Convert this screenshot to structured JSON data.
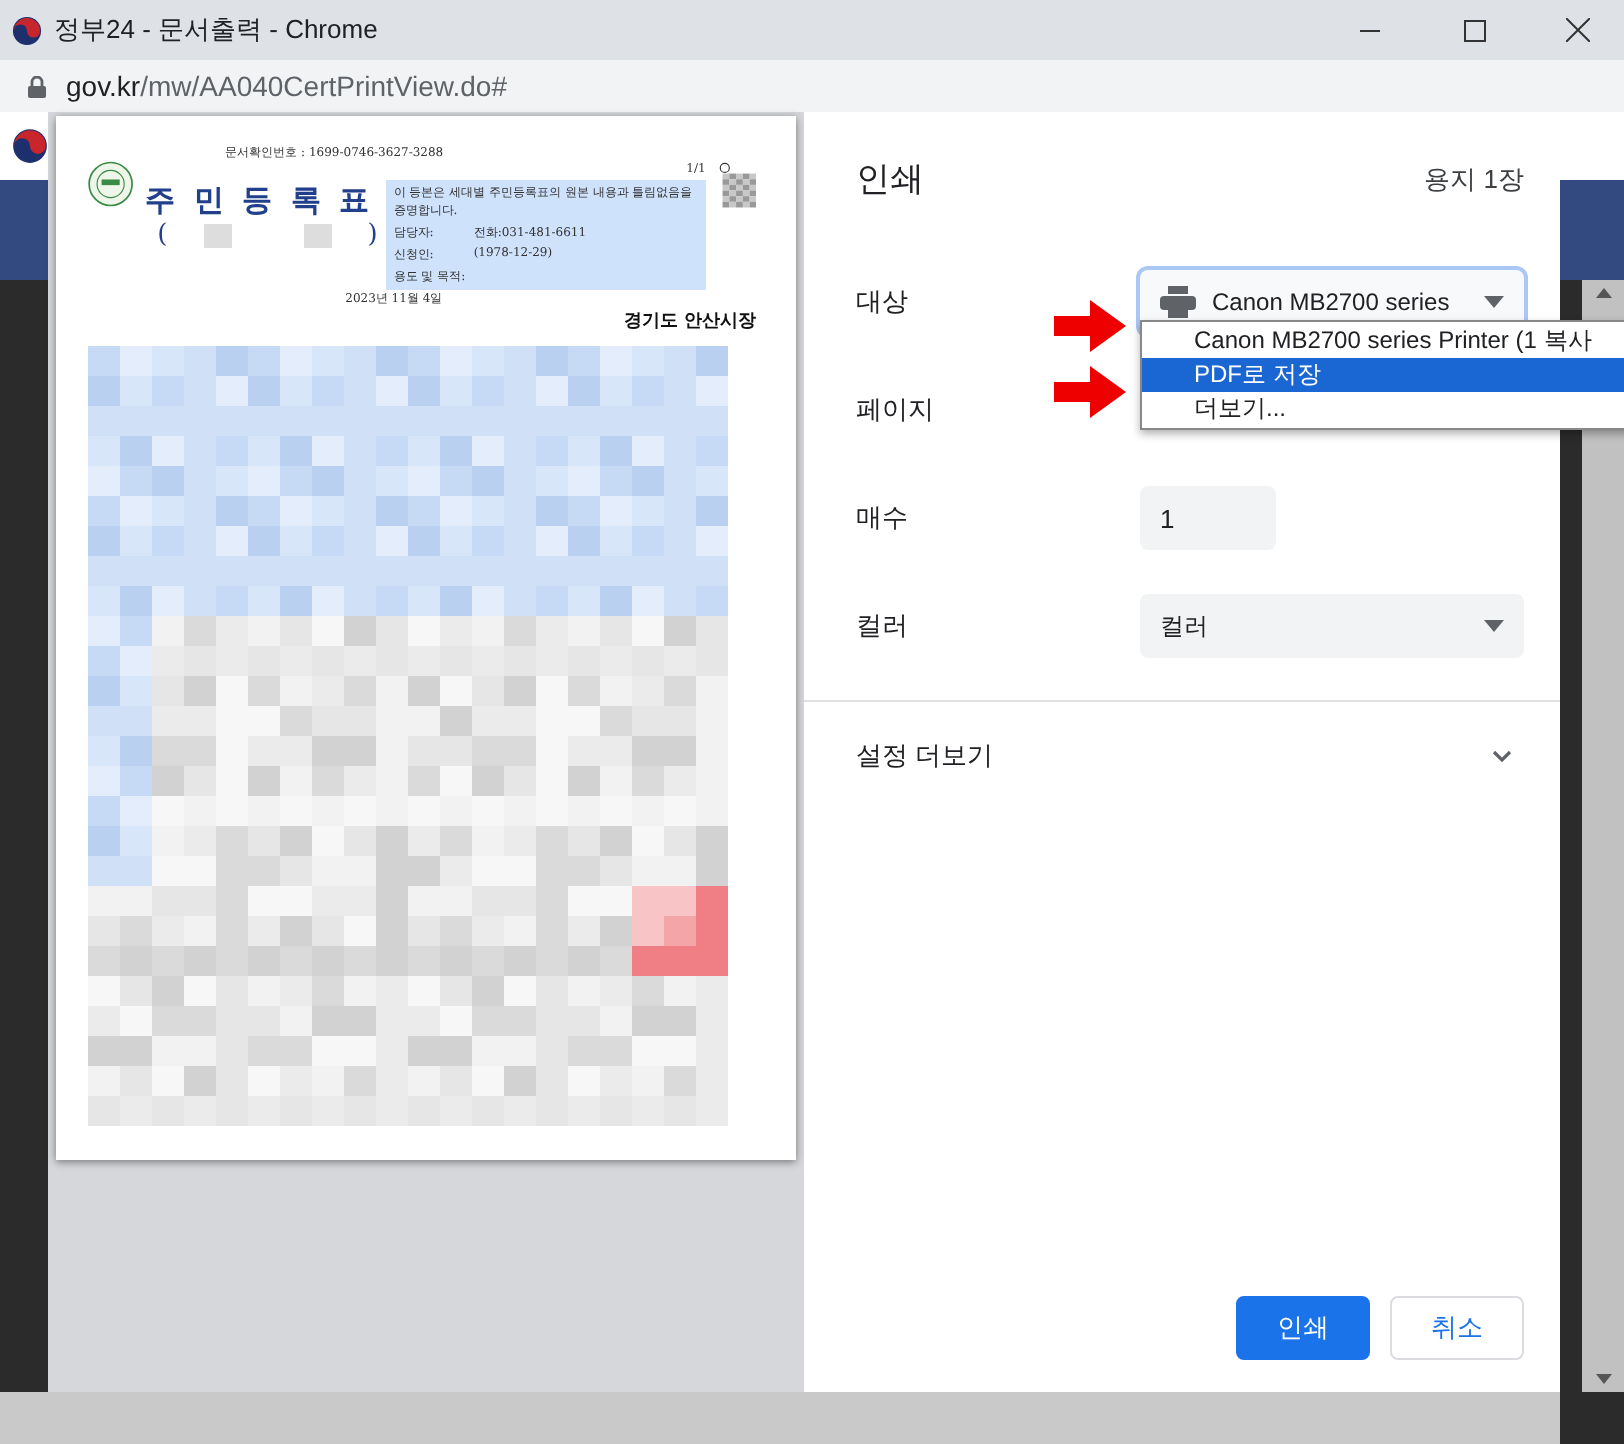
{
  "window": {
    "title": "정부24 - 문서출력 - Chrome",
    "address_host": "gov.kr",
    "address_path": "/mw/AA040CertPrintView.do#"
  },
  "document": {
    "doc_number": "문서확인번호 : 1699-0746-3627-3288",
    "page": "1/1",
    "title": "주 민 등 록 표",
    "paren_open": "(",
    "paren_close": ")",
    "notice": "이 등본은 세대별 주민등록표의 원본 내용과 틀림없음을 증명합니다.",
    "rows": [
      {
        "label": "담당자:",
        "value": "전화:031-481-6611"
      },
      {
        "label": "신청인:",
        "value": "(1978-12-29)"
      },
      {
        "label": "용도 및 목적:",
        "value": ""
      }
    ],
    "date": "2023년 11월 4일",
    "issuer": "경기도 안산시장"
  },
  "panel": {
    "title": "인쇄",
    "sheets": "용지 1장",
    "fields": [
      {
        "label": "대상",
        "kind": "printer",
        "value": "Canon MB2700 series",
        "focused": true
      },
      {
        "label": "페이지",
        "kind": "none"
      },
      {
        "label": "매수",
        "kind": "input",
        "value": "1"
      },
      {
        "label": "컬러",
        "kind": "select",
        "value": "컬러"
      }
    ],
    "more_settings": {
      "label": "설정 더보기",
      "expanded": false
    },
    "buttons": [
      {
        "label": "인쇄",
        "kind": "primary"
      },
      {
        "label": "취소",
        "kind": "secondary"
      }
    ]
  },
  "dropdown": [
    {
      "label": "Canon MB2700 series Printer (1 복사",
      "selected": false
    },
    {
      "label": "PDF로 저장",
      "selected": true
    },
    {
      "label": "더보기...",
      "selected": false
    }
  ],
  "annotations": [
    {
      "kind": "arrow",
      "color": "#ee0000"
    },
    {
      "kind": "arrow",
      "color": "#ee0000"
    }
  ]
}
